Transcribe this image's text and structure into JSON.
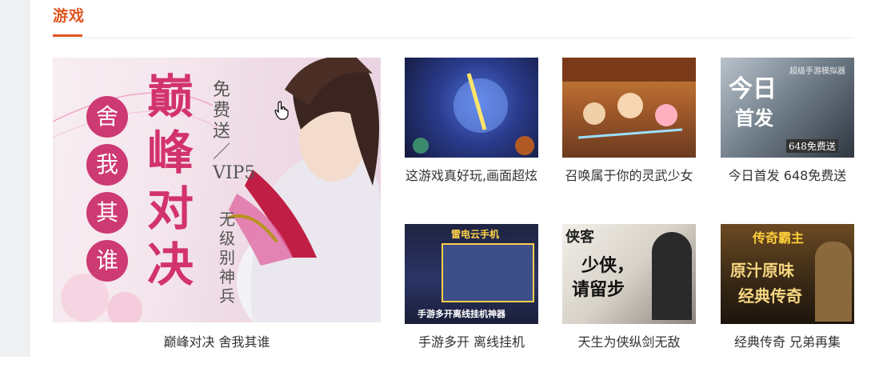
{
  "section": {
    "title": "游戏"
  },
  "feature": {
    "caption": "巅峰对决 舍我其谁",
    "banner": {
      "title": "巅峰对决",
      "circles": [
        "舍",
        "我",
        "其",
        "谁"
      ],
      "vertical_text": "免费送／VIP5",
      "vertical_text_2": "无级别神兵"
    }
  },
  "games": [
    {
      "caption": "这游戏真好玩,画面超炫"
    },
    {
      "caption": "召唤属于你的灵武少女"
    },
    {
      "caption": "今日首发 648免费送",
      "overlay": [
        "今日",
        "首发",
        "648免费送"
      ],
      "tag": "超级手游模拟器"
    },
    {
      "caption": "手游多开 离线挂机",
      "overlay_top": "雷电云手机",
      "overlay_bottom": "手游多开离线挂机神器"
    },
    {
      "caption": "天生为侠纵剑无敌",
      "overlay": [
        "少侠，",
        "请留步"
      ],
      "logo": "侠客"
    },
    {
      "caption": "经典传奇 兄弟再集",
      "overlay": [
        "原汁原味",
        "经典传奇"
      ],
      "logo": "传奇霸主"
    }
  ],
  "icons": {
    "cursor": "hand-pointer-icon"
  },
  "colors": {
    "accent": "#e0561f",
    "rail": "#eef0f1",
    "text": "#333333"
  }
}
